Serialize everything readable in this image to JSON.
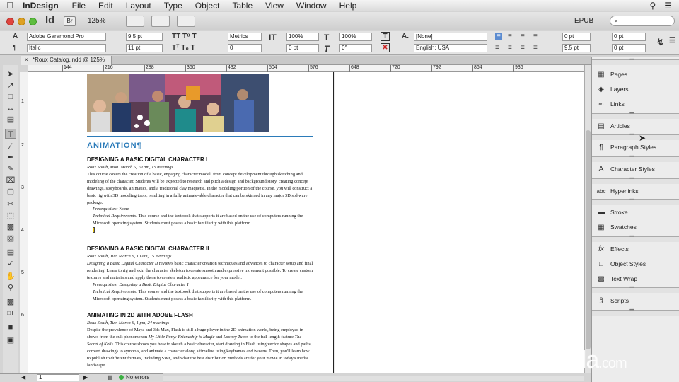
{
  "menubar": {
    "app": "InDesign",
    "items": [
      "File",
      "Edit",
      "Layout",
      "Type",
      "Object",
      "Table",
      "View",
      "Window",
      "Help"
    ]
  },
  "appbar": {
    "logo": "Id",
    "bridge": "Br",
    "zoom": "125%",
    "workspace": "EPUB",
    "search_placeholder": "⌕"
  },
  "control": {
    "font_family": "Adobe Garamond Pro",
    "font_style": "Italic",
    "font_size": "9.5 pt",
    "leading": "11 pt",
    "kerning": "Metrics",
    "tracking": "0",
    "vscale": "100%",
    "hscale": "100%",
    "baseline": "0 pt",
    "skew": "0°",
    "char_style": "[None]",
    "language": "English: USA",
    "indent_left": "0 pt",
    "indent_first": "9.5 pt",
    "indent_right": "0 pt",
    "indent_last": "0 pt"
  },
  "document": {
    "tab_title": "*Roux Catalog.indd @ 125%"
  },
  "ruler": {
    "marks": [
      "144",
      "216",
      "288",
      "360",
      "432",
      "504",
      "576",
      "648",
      "720",
      "792",
      "864",
      "936"
    ]
  },
  "vruler": {
    "marks": [
      "1",
      "2",
      "3",
      "4",
      "5",
      "6"
    ]
  },
  "content": {
    "section": "ANIMATION",
    "c1_title": "DESIGNING A BASIC DIGITAL CHARACTER I",
    "c1_meta": "Roux South, Mon. March 5, 10 am, 15 meetings",
    "c1_body": "This course covers the creation of a basic, engaging character model, from concept development through sketching and modeling of the character. Students will be expected to research and pitch a design and background story, creating concept drawings, storyboards, animatics, and a traditional clay maquette. In the modeling portion of the course, you will construct a basic rig with 3D modeling tools, resulting in a fully animate-able character that can be skinned in any major 3D software package.",
    "c1_prereq_label": "Prerequisites:",
    "c1_prereq": "None",
    "c1_tech_label": "Technical Requirements:",
    "c1_tech": "This course and the textbook that supports it are based on the use of computers running the Microsoft operating system. Students must posess a basic familiarity with this platform.",
    "c2_title": "DESIGNING A BASIC DIGITAL CHARACTER II",
    "c2_meta": "Roux South, Tue. March 6, 10 am, 15 meetings",
    "c2_body_italic": "Designing a Basic Digital Character II",
    "c2_body": " reviews basic character creation techniques and advances to character setup and final rendering. Learn to rig and skin the character skeleton to create smooth and expressive movement possible. To create custom textures and materials and apply these to create a realistic appearance for your model.",
    "c2_prereq_label": "Prerequisites:",
    "c2_prereq": "Designing a Basic Digital Character I",
    "c2_tech_label": "Technical Requirements:",
    "c2_tech": "This course and the textbook that supports it are based on the use of computers running the Microsoft operating system. Students must posess a basic familiarity with this platform.",
    "c3_title": "ANIMATING IN 2D WITH ADOBE FLASH",
    "c3_meta": "Roux South, Tue. March 6, 1 pm, 24 meetings",
    "c3_body_a": "Despite the prevalence of Maya and 3ds Max, Flash is still a huge player in the 2D animation world, being employed in shows from the cult phenomenon ",
    "c3_body_i1": "My Little Pony: Friendship is Magic",
    "c3_body_b": " and ",
    "c3_body_i2": "Looney Tunes",
    "c3_body_c": " to the full-length feature ",
    "c3_body_i3": "The Secret of Kells",
    "c3_body_d": ". This course shows you how to sketch a basic character, start drawing in Flash using vector shapes and paths, convert drawings to symbols, and animate a character along a timeline using keyframes and tweens. Then, you'll learn how to publish to different formats, including SWF, and what the best distribution methods are for your movie in today's media landscape."
  },
  "status": {
    "page": "1",
    "errors": "No errors"
  },
  "panel": {
    "items": [
      "Pages",
      "Layers",
      "Links",
      "Articles",
      "Paragraph Styles",
      "Character Styles",
      "Hyperlinks",
      "Stroke",
      "Swatches",
      "Effects",
      "Object Styles",
      "Text Wrap",
      "Scripts"
    ]
  },
  "watermark": {
    "text": "lynda",
    "suffix": ".com"
  },
  "colors": {
    "accent_blue": "#2b7bb9",
    "guide_magenta": "#d7a3d9"
  }
}
